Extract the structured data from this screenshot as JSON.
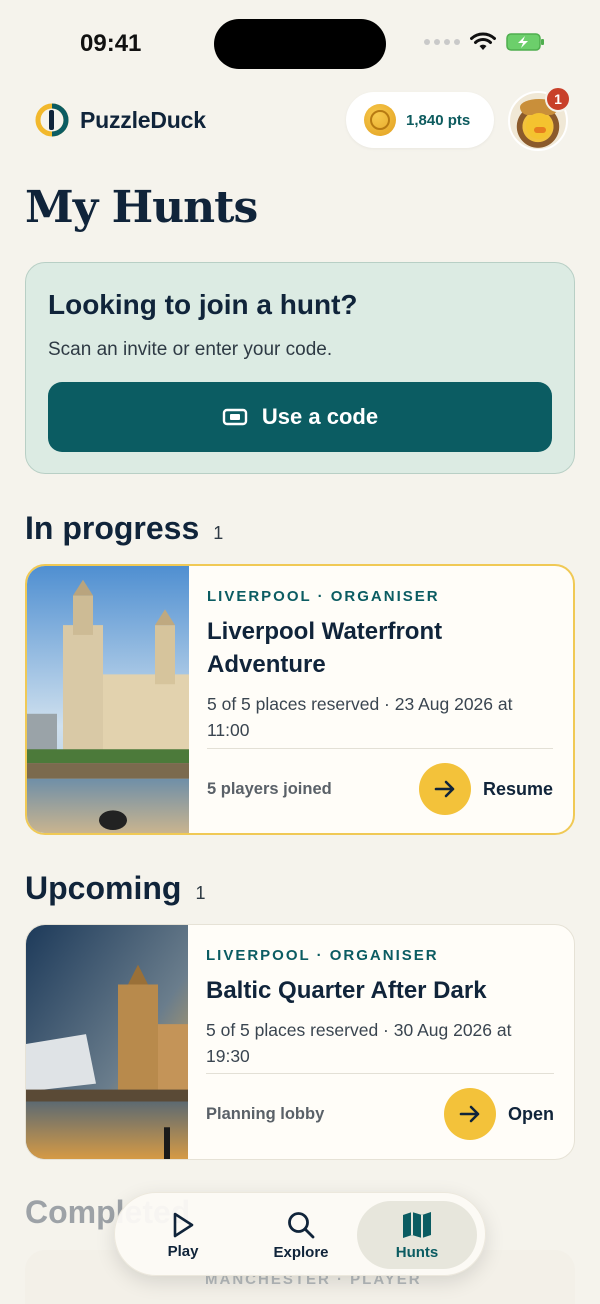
{
  "status_bar": {
    "time": "09:41"
  },
  "header": {
    "app_name": "PuzzleDuck",
    "points": "1,840 pts",
    "notification_count": "1"
  },
  "page_title": "My Hunts",
  "join_card": {
    "title": "Looking to join a hunt?",
    "subtitle": "Scan an invite or enter your code.",
    "button_label": "Use a code"
  },
  "sections": {
    "in_progress": {
      "title": "In progress",
      "count": "1"
    },
    "upcoming": {
      "title": "Upcoming",
      "count": "1"
    },
    "completed": {
      "title": "Completed"
    }
  },
  "hunts": [
    {
      "meta": "LIVERPOOL · ORGANISER",
      "title": "Liverpool Waterfront Adventure",
      "info": "5 of 5 places reserved · 23 Aug 2026 at 11:00",
      "status": "5 players joined",
      "action": "Resume"
    },
    {
      "meta": "LIVERPOOL · ORGANISER",
      "title": "Baltic Quarter After Dark",
      "info": "5 of 5 places reserved · 30 Aug 2026 at 19:30",
      "status": "Planning lobby",
      "action": "Open"
    }
  ],
  "completed_preview": {
    "meta": "MANCHESTER · PLAYER"
  },
  "tab_bar": {
    "tabs": [
      {
        "label": "Play",
        "icon": "play-icon"
      },
      {
        "label": "Explore",
        "icon": "search-icon"
      },
      {
        "label": "Hunts",
        "icon": "map-icon"
      }
    ],
    "active": "Hunts"
  },
  "colors": {
    "accent": "#0b5c62",
    "highlight": "#f3c23a",
    "background": "#f5f3ec"
  }
}
